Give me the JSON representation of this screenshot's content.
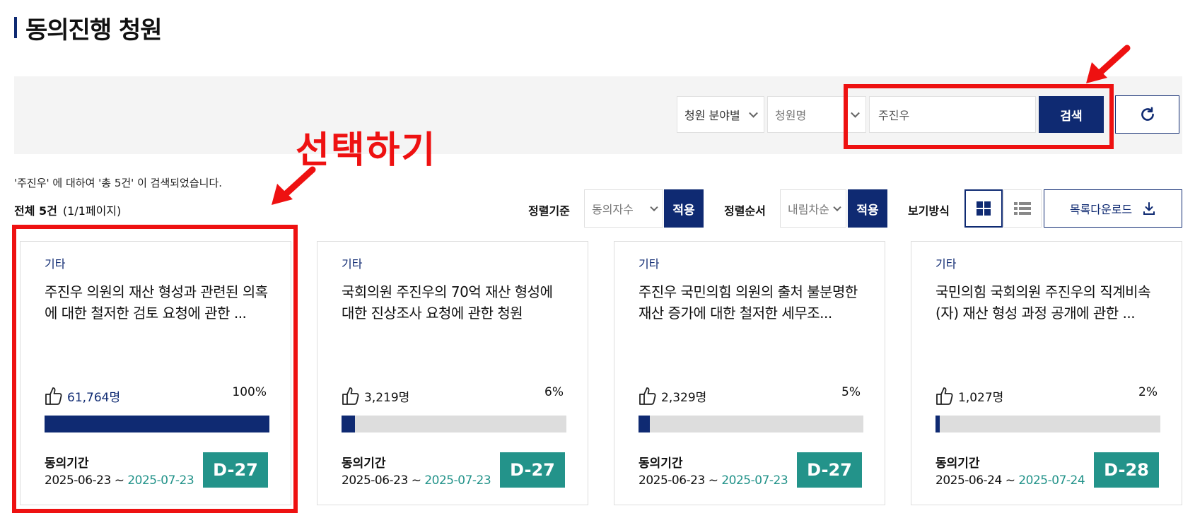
{
  "page": {
    "title": "동의진행 청원"
  },
  "search": {
    "category_select": "청원 분야별",
    "field_select": "청원명",
    "query_value": "주진우",
    "search_label": "검색"
  },
  "results": {
    "summary": "'주진우' 에 대하여 '총 5건' 이 검색되었습니다.",
    "total_label": "전체 5건",
    "page_info": "(1/1페이지)"
  },
  "controls": {
    "sort_label": "정렬기준",
    "sort_value": "동의자수",
    "order_label": "정렬순서",
    "order_value": "내림차순",
    "apply_label": "적용",
    "view_label": "보기방식",
    "download_label": "목록다운로드"
  },
  "annotation": {
    "text": "선택하기",
    "color": "#ee1111"
  },
  "colors": {
    "primary": "#0f2a72",
    "accent": "#23938a",
    "annotation": "#ee1111"
  },
  "period_label": "동의기간",
  "cards": [
    {
      "category": "기타",
      "title": "주진우 의원의 재산 형성과 관련된 의혹에 대한 철저한 검토 요청에 관한 ...",
      "likes": "61,764명",
      "percent": "100%",
      "progress": 100,
      "start": "2025-06-23 ~ ",
      "end": "2025-07-23",
      "dday": "D-27"
    },
    {
      "category": "기타",
      "title": "국회의원 주진우의 70억 재산 형성에 대한 진상조사 요청에 관한 청원",
      "likes": "3,219명",
      "percent": "6%",
      "progress": 6,
      "start": "2025-06-23 ~ ",
      "end": "2025-07-23",
      "dday": "D-27"
    },
    {
      "category": "기타",
      "title": "주진우 국민의힘 의원의 출처 불분명한 재산 증가에 대한 철저한 세무조...",
      "likes": "2,329명",
      "percent": "5%",
      "progress": 5,
      "start": "2025-06-23 ~ ",
      "end": "2025-07-23",
      "dday": "D-27"
    },
    {
      "category": "기타",
      "title": "국민의힘 국회의원 주진우의 직계비속(자) 재산 형성 과정 공개에 관한 ...",
      "likes": "1,027명",
      "percent": "2%",
      "progress": 2,
      "start": "2025-06-24 ~ ",
      "end": "2025-07-24",
      "dday": "D-28"
    }
  ]
}
